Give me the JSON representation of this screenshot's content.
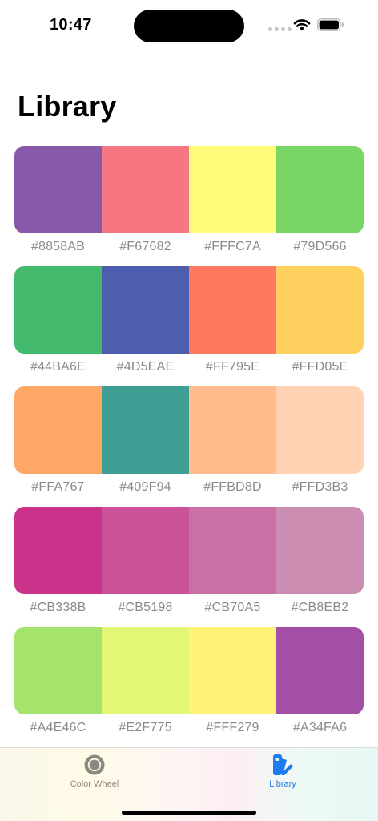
{
  "status_bar": {
    "time": "10:47"
  },
  "page": {
    "title": "Library"
  },
  "palettes": [
    {
      "colors": [
        "#8858AB",
        "#F67682",
        "#FFFC7A",
        "#79D566"
      ]
    },
    {
      "colors": [
        "#44BA6E",
        "#4D5EAE",
        "#FF795E",
        "#FFD05E"
      ]
    },
    {
      "colors": [
        "#FFA767",
        "#409F94",
        "#FFBD8D",
        "#FFD3B3"
      ]
    },
    {
      "colors": [
        "#CB338B",
        "#CB5198",
        "#CB70A5",
        "#CB8EB2"
      ]
    },
    {
      "colors": [
        "#A4E46C",
        "#E2F775",
        "#FFF279",
        "#A34FA6"
      ]
    }
  ],
  "tab_bar": {
    "tabs": [
      {
        "label": "Color Wheel",
        "icon": "color-wheel-icon",
        "selected": false
      },
      {
        "label": "Library",
        "icon": "palette-library-icon",
        "selected": true
      }
    ],
    "accent_color": "#1A7CF0",
    "inactive_color": "#8C8A80"
  }
}
